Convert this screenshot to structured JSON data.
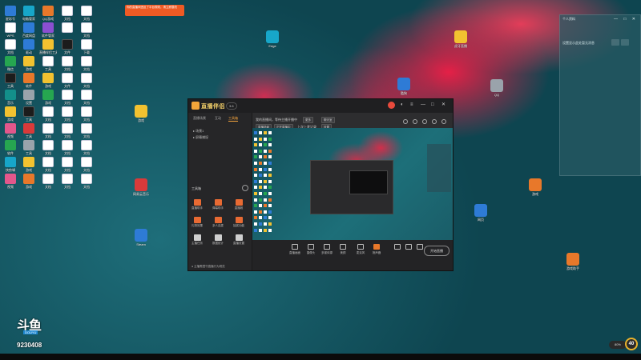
{
  "desktop_icons": [
    {
      "label": "星彩号",
      "color": "blue"
    },
    {
      "label": "电脑管家",
      "color": "cyan"
    },
    {
      "label": "QQ游戏",
      "color": "orange"
    },
    {
      "label": "文档",
      "color": "doc"
    },
    {
      "label": "文档",
      "color": "doc"
    },
    {
      "label": "WPS",
      "color": "doc"
    },
    {
      "label": "百度网盘",
      "color": "blue"
    },
    {
      "label": "软件管家",
      "color": "purple"
    },
    {
      "label": "",
      "color": "doc"
    },
    {
      "label": "文档",
      "color": "doc"
    },
    {
      "label": "文档",
      "color": "doc"
    },
    {
      "label": "驱动",
      "color": "blue"
    },
    {
      "label": "直播伴侣工具",
      "color": "yellow"
    },
    {
      "label": "文件",
      "color": "dark"
    },
    {
      "label": "下载",
      "color": "doc"
    },
    {
      "label": "微信",
      "color": "green"
    },
    {
      "label": "游戏",
      "color": "yellow"
    },
    {
      "label": "工具",
      "color": "doc"
    },
    {
      "label": "文档",
      "color": "doc"
    },
    {
      "label": "文档",
      "color": "doc"
    },
    {
      "label": "工具",
      "color": "dark"
    },
    {
      "label": "软件",
      "color": "orange"
    },
    {
      "label": "游戏",
      "color": "yellow"
    },
    {
      "label": "文件",
      "color": "doc"
    },
    {
      "label": "文档",
      "color": "doc"
    },
    {
      "label": "音乐",
      "color": "teal"
    },
    {
      "label": "设置",
      "color": "gray"
    },
    {
      "label": "游戏",
      "color": "green"
    },
    {
      "label": "文档",
      "color": "doc"
    },
    {
      "label": "文档",
      "color": "doc"
    },
    {
      "label": "游戏",
      "color": "yellow"
    },
    {
      "label": "工具",
      "color": "dark"
    },
    {
      "label": "文档",
      "color": "doc"
    },
    {
      "label": "文档",
      "color": "doc"
    },
    {
      "label": "文档",
      "color": "doc"
    },
    {
      "label": "视频",
      "color": "pink"
    },
    {
      "label": "工具",
      "color": "red"
    },
    {
      "label": "文档",
      "color": "doc"
    },
    {
      "label": "文档",
      "color": "doc"
    },
    {
      "label": "文档",
      "color": "doc"
    },
    {
      "label": "软件",
      "color": "green"
    },
    {
      "label": "工具",
      "color": "gray"
    },
    {
      "label": "文档",
      "color": "doc"
    },
    {
      "label": "文档",
      "color": "doc"
    },
    {
      "label": "文档",
      "color": "doc"
    },
    {
      "label": "快剪辑",
      "color": "cyan"
    },
    {
      "label": "游戏",
      "color": "yellow"
    },
    {
      "label": "文档",
      "color": "doc"
    },
    {
      "label": "文档",
      "color": "doc"
    },
    {
      "label": "文档",
      "color": "doc"
    },
    {
      "label": "视频",
      "color": "pink"
    },
    {
      "label": "游戏",
      "color": "orange"
    },
    {
      "label": "文档",
      "color": "doc"
    },
    {
      "label": "文档",
      "color": "doc"
    },
    {
      "label": "文档",
      "color": "doc"
    }
  ],
  "floating_icons": [
    {
      "label": "游戏",
      "color": "yellow"
    },
    {
      "label": "网易云音乐",
      "color": "red"
    },
    {
      "label": "Steam",
      "color": "blue"
    },
    {
      "label": "Edge",
      "color": "cyan"
    },
    {
      "label": "酷狗",
      "color": "blue"
    },
    {
      "label": "QQ",
      "color": "gray"
    },
    {
      "label": "虎牙直播",
      "color": "yellow"
    },
    {
      "label": "游戏",
      "color": "orange"
    },
    {
      "label": "网页",
      "color": "blue"
    },
    {
      "label": "游戏助手",
      "color": "orange"
    }
  ],
  "right_panel": {
    "title": "个人资料",
    "controls": "— □ ✕",
    "message": "设置显示此处暂无消息"
  },
  "app": {
    "name": "直播伴侣",
    "version": "3.6",
    "notice": "你的直播间违反了平台规则，请立即整改",
    "left_tabs": [
      "直播场景",
      "互动",
      "工具箱"
    ],
    "left_rows": [
      "▸ 场景1",
      "▸ 屏幕捕捉"
    ],
    "tools_header": "工具箱",
    "tools": [
      {
        "label": "直播助手",
        "color": "orange"
      },
      {
        "label": "弹幕助手",
        "color": "orange"
      },
      {
        "label": "直播姬",
        "color": "orange"
      },
      {
        "label": "礼物效果",
        "color": "orange"
      },
      {
        "label": "多人连麦",
        "color": "orange"
      },
      {
        "label": "抽奖功能",
        "color": "orange"
      },
      {
        "label": "主播任务",
        "color": "white"
      },
      {
        "label": "数据统计",
        "color": "white"
      },
      {
        "label": "直播设置",
        "color": "white"
      }
    ],
    "bottom_note": "● 主播需遵守直播行为规范",
    "toolbar": {
      "line1": "我的直播间，等待主播开播中",
      "btn1": "更多",
      "btn2": "聊天室",
      "line2": "直播场景",
      "btn3": "正在直播中",
      "line3": "上次上麦记录",
      "btn4": "设置"
    },
    "controls": [
      {
        "label": "直播画面"
      },
      {
        "label": "摄像头"
      },
      {
        "label": "多媒体源"
      },
      {
        "label": "美颜"
      },
      {
        "label": "麦克风"
      },
      {
        "label": "扬声器"
      },
      {
        "label": ""
      },
      {
        "label": ""
      },
      {
        "label": ""
      }
    ],
    "start_live": "开始直播"
  },
  "watermark": {
    "logo": "斗鱼",
    "sub": "DOUYU",
    "id": "9230408"
  },
  "badge": {
    "pill": "80%",
    "circle": "40"
  }
}
